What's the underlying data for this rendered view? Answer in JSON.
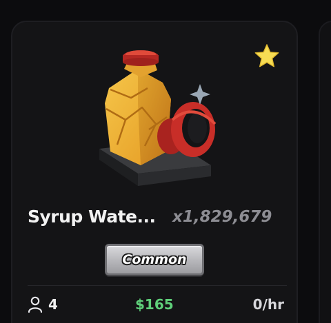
{
  "item": {
    "name": "Syrup Wate...",
    "count": "x1,829,679",
    "rarity": "Common",
    "icon": "syrup-jug-icon",
    "favorited": true
  },
  "stats": {
    "owners_icon": "person-icon",
    "owners": "4",
    "price": "$165",
    "rate": "0/hr"
  },
  "colors": {
    "card_background": "#141416",
    "price_green": "#5fd07a",
    "star_yellow": "#f7dd54",
    "rarity_common": "#bdbdc1"
  }
}
